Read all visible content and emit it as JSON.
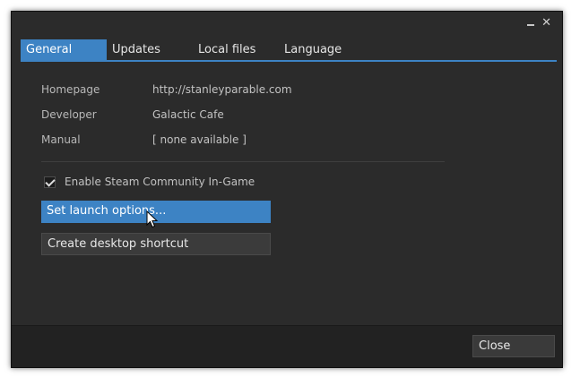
{
  "window": {
    "controls": {
      "minimize_icon": "minimize-icon",
      "close_glyph": "✕"
    }
  },
  "tabs": [
    {
      "label": "General",
      "active": true
    },
    {
      "label": "Updates",
      "active": false
    },
    {
      "label": "Local files",
      "active": false
    },
    {
      "label": "Language",
      "active": false
    }
  ],
  "info": {
    "homepage_label": "Homepage",
    "homepage_value": "http://stanleyparable.com",
    "developer_label": "Developer",
    "developer_value": "Galactic Cafe",
    "manual_label": "Manual",
    "manual_value": "[ none available ]"
  },
  "options": {
    "steam_community_label": "Enable Steam Community In-Game",
    "steam_community_checked": true,
    "launch_options_label": "Set launch options...",
    "desktop_shortcut_label": "Create desktop shortcut"
  },
  "footer": {
    "close_label": "Close"
  },
  "colors": {
    "accent": "#3d83c4",
    "background": "#2b2b2b",
    "footer": "#222222"
  }
}
